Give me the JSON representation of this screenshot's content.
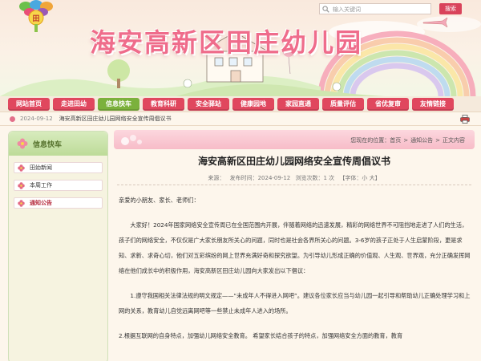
{
  "header": {
    "site_title": "海安高新区田庄幼儿园",
    "search_placeholder": "输入关键词",
    "search_button": "搜索"
  },
  "colors": {
    "accent": "#d9435b",
    "title_pink": "#ef6c8b",
    "nav_red": "#e0475e",
    "nav_green": "#7bb13c",
    "sidebar_green": "#bddb98"
  },
  "nav": {
    "items": [
      {
        "label": "网站首页",
        "color": "#e0475e"
      },
      {
        "label": "走进田幼",
        "color": "#e0475e"
      },
      {
        "label": "信息快车",
        "color": "#7bb13c"
      },
      {
        "label": "教育科研",
        "color": "#e0475e"
      },
      {
        "label": "安全驿站",
        "color": "#e0475e"
      },
      {
        "label": "健康园地",
        "color": "#e0475e"
      },
      {
        "label": "家园直通",
        "color": "#e0475e"
      },
      {
        "label": "质量评估",
        "color": "#e0475e"
      },
      {
        "label": "省优复审",
        "color": "#e0475e"
      },
      {
        "label": "友情链接",
        "color": "#e0475e"
      }
    ]
  },
  "ticker": {
    "date": "2024-09-12",
    "text": "海安高新区田庄幼儿园网络安全宣传周倡议书"
  },
  "sidebar": {
    "title": "信息快车",
    "items": [
      {
        "label": "田幼新闻",
        "icon": "flower-icon"
      },
      {
        "label": "本周工作",
        "icon": "flower-icon"
      },
      {
        "label": "通知公告",
        "icon": "flower-icon"
      }
    ]
  },
  "breadcrumb": {
    "prefix": "您现在的位置：",
    "home": "首页",
    "sep": ">",
    "section": "通知公告",
    "current": "正文内容"
  },
  "article": {
    "title": "海安高新区田庄幼儿园网络安全宣传周倡议书",
    "meta": {
      "source": "来源：",
      "date": "发布时间：2024-09-12",
      "views": "浏览次数：1 次",
      "font": "【字体：小 大】"
    },
    "greeting": "亲爱的小朋友、家长、老师们：",
    "paragraphs": [
      "大家好！2024年国家网络安全宣传周已在全国范围内开展，伴随着网络的迅速发展，精彩的网络世界不可阻挡地走进了人们的生活，孩子们的网络安全，不仅仅是广大家长朋友所关心的问题，同时也是社会各界所关心的问题。3-6岁的孩子正处于人生启蒙阶段，更是求知、求新、求奇心切，他们对五彩缤纷的网上世界充满好奇和探究欲望。为引导幼儿形成正确的价值观、人生观、世界观，充分正确发挥网络在他们成长中的积极作用，海安高新区田庄幼儿园向大家发出以下倡议：",
      "1.遵守我国相关法律法规的明文规定——“未成年人不得进入网吧”。建议各位家长应当与幼儿园一起引导和帮助幼儿正确处理学习和上网的关系，教育幼儿自觉远离网吧等一些禁止未成年人进入的场所。",
      "2.根据互联网的自身特点，加强幼儿网络安全教育。  希望家长结合孩子的特点，加强网络安全方面的教育，教育"
    ]
  }
}
